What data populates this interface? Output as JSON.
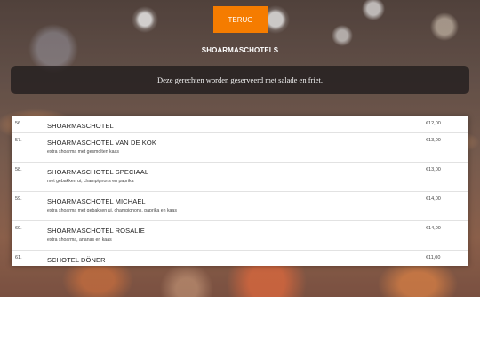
{
  "header": {
    "back_label": "TERUG",
    "title": "SHOARMASCHOTELS"
  },
  "notice": {
    "text": "Deze gerechten worden geserveerd met salade en friet."
  },
  "menu": {
    "items": [
      {
        "number": "56.",
        "name": "SHOARMASCHOTEL",
        "description": "",
        "price": "€12,00"
      },
      {
        "number": "57.",
        "name": "SHOARMASCHOTEL VAN DE KOK",
        "description": "extra shoarma met gesmolten kaas",
        "price": "€13,00"
      },
      {
        "number": "58.",
        "name": "SHOARMASCHOTEL SPECIAAL",
        "description": "met gebakken ui, champignons en paprika",
        "price": "€13,00"
      },
      {
        "number": "59.",
        "name": "SHOARMASCHOTEL MICHAEL",
        "description": "extra shoarma met gebakken ui, champignons, paprika en kaas",
        "price": "€14,00"
      },
      {
        "number": "60.",
        "name": "SHOARMASCHOTEL ROSALIE",
        "description": "extra shoarma, ananas en kaas",
        "price": "€14,00"
      },
      {
        "number": "61.",
        "name": "SCHOTEL DÖNER",
        "description": "",
        "price": "€11,00"
      }
    ]
  }
}
